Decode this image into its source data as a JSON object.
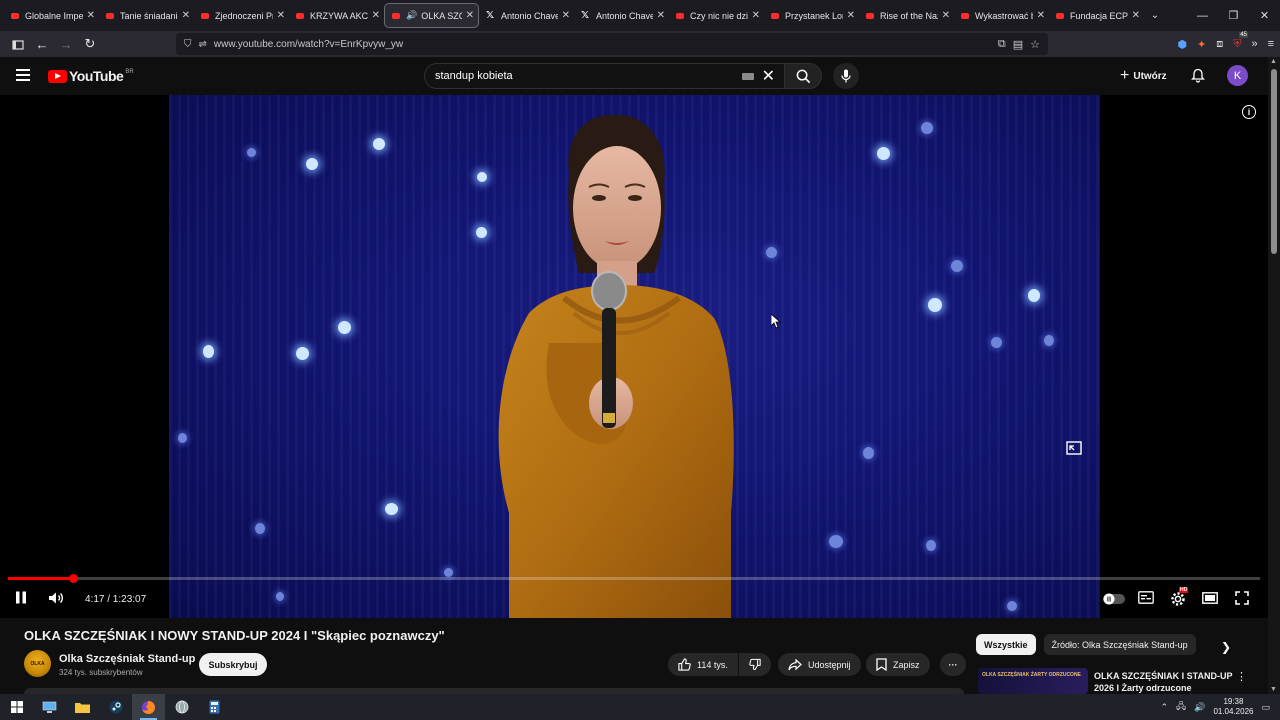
{
  "tabs": [
    {
      "title": "Globalne Imperi",
      "favicon": "youtube-icon",
      "active": false
    },
    {
      "title": "Tanie śniadanie",
      "favicon": "youtube-icon",
      "active": false
    },
    {
      "title": "Zjednoczeni Pra",
      "favicon": "youtube-icon",
      "active": false
    },
    {
      "title": "KRZYWA AKCJA",
      "favicon": "youtube-icon",
      "active": false
    },
    {
      "title": "OLKA SZCZ",
      "favicon": "youtube-icon",
      "active": true,
      "audio": true
    },
    {
      "title": "Antonio Chavez",
      "favicon": "x-icon",
      "active": false
    },
    {
      "title": "Antonio Chavez",
      "favicon": "x-icon",
      "active": false
    },
    {
      "title": "Czy nic nie dzieje",
      "favicon": "youtube-icon",
      "active": false
    },
    {
      "title": "Przystanek Loms",
      "favicon": "youtube-icon",
      "active": false
    },
    {
      "title": "Rise of the Nazi",
      "favicon": "youtube-icon",
      "active": false
    },
    {
      "title": "Wykastrować b",
      "favicon": "youtube-icon",
      "active": false
    },
    {
      "title": "Fundacja ECPU",
      "favicon": "youtube-icon",
      "active": false
    }
  ],
  "browser": {
    "url": "www.youtube.com/watch?v=EnrKpvyw_yw",
    "extension_badge": "45"
  },
  "youtube": {
    "logo_text": "YouTube",
    "country_code": "BR",
    "search_value": "standup kobieta",
    "create_label": "Utwórz",
    "avatar_letter": "K"
  },
  "player": {
    "current_time": "4:17",
    "duration": "1:23:07",
    "time_display": "4:17 / 1:23:07",
    "progress_fraction": 0.0516,
    "settings_badge": "HD"
  },
  "video": {
    "title": "OLKA SZCZĘŚNIAK I NOWY STAND-UP 2024 I \"Skąpiec poznawczy\"",
    "channel_name": "Olka Szczęśniak Stand-up",
    "channel_avatar_text": "OLKA",
    "subscribers": "324 tys. subskrybentów",
    "subscribe_label": "Subskrybuj",
    "likes": "114 tys.",
    "share_label": "Udostępnij",
    "save_label": "Zapisz"
  },
  "sidebar": {
    "chips": [
      "Wszystkie",
      "Źródło: Olka Szczęśniak Stand-up"
    ],
    "related": [
      {
        "title": "OLKA SZCZĘŚNIAK I STAND-UP 2026 I Żarty odrzucone",
        "thumb_text": "OLKA SZCZĘŚNIAK  ŻARTY ODRZUCONE"
      }
    ]
  },
  "taskbar": {
    "time": "19:38",
    "date": "01.04.2026"
  },
  "colors": {
    "accent_red": "#ff0000",
    "background": "#0f0f0f",
    "stage_blue": "#131677"
  }
}
